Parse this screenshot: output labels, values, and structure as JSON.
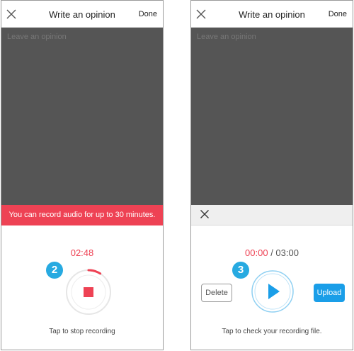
{
  "colors": {
    "accent_red": "#ee4254",
    "accent_blue": "#1a9ee8",
    "badge_blue": "#27aae1",
    "overlay_gray": "#555555"
  },
  "screen_recording": {
    "header": {
      "close_icon": "close-icon",
      "title": "Write an opinion",
      "done_label": "Done"
    },
    "editor_placeholder": "Leave an opinion",
    "banner_text": "You can record audio for up to 30 minutes.",
    "step_badge": "2",
    "timer": "02:48",
    "record_progress_fraction": 0.09,
    "stop_icon": "stop-icon",
    "caption": "Tap to stop recording"
  },
  "screen_playback": {
    "header": {
      "close_icon": "close-icon",
      "title": "Write an opinion",
      "done_label": "Done"
    },
    "editor_placeholder": "Leave an opinion",
    "dismiss_icon": "close-icon",
    "step_badge": "3",
    "timer_elapsed": "00:00",
    "timer_separator": " / ",
    "timer_total": "03:00",
    "play_icon": "play-icon",
    "delete_label": "Delete",
    "upload_label": "Upload",
    "caption": "Tap to check your recording file."
  }
}
